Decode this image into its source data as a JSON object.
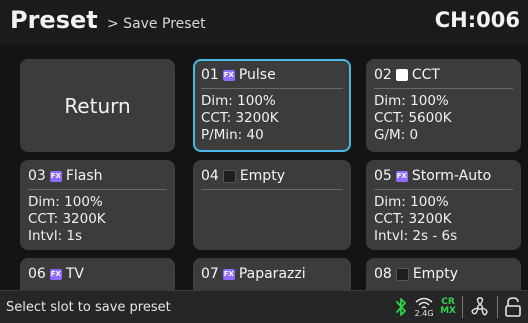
{
  "header": {
    "title": "Preset",
    "breadcrumb": "> Save Preset",
    "channel": "CH:006"
  },
  "return_label": "Return",
  "slots": [
    {
      "num": "01",
      "icon": "fx-icon",
      "name": "Pulse",
      "lines": [
        "Dim: 100%",
        "CCT: 3200K",
        "P/Min: 40"
      ],
      "selected": true
    },
    {
      "num": "02",
      "icon": "cct-white-square-icon",
      "name": "CCT",
      "lines": [
        "Dim: 100%",
        "CCT: 5600K",
        "G/M: 0"
      ]
    },
    {
      "num": "03",
      "icon": "fx-icon",
      "name": "Flash",
      "lines": [
        "Dim: 100%",
        "CCT: 3200K",
        "Intvl: 1s"
      ]
    },
    {
      "num": "04",
      "icon": "empty-square-icon",
      "name": "Empty",
      "lines": []
    },
    {
      "num": "05",
      "icon": "fx-icon",
      "name": "Storm-Auto",
      "lines": [
        "Dim: 100%",
        "CCT: 3200K",
        "Intvl: 2s - 6s"
      ]
    },
    {
      "num": "06",
      "icon": "fx-icon",
      "name": "TV",
      "lines": []
    },
    {
      "num": "07",
      "icon": "fx-icon",
      "name": "Paparazzi",
      "lines": []
    },
    {
      "num": "08",
      "icon": "empty-square-icon",
      "name": "Empty",
      "lines": []
    }
  ],
  "fx_badge": "FX",
  "footer": {
    "status": "Select slot to save preset",
    "freq_label": "2.4G",
    "crmx_top": "CR",
    "crmx_bottom": "MX",
    "icons": [
      "bluetooth-icon",
      "wireless-2-4g-icon",
      "crmx-icon",
      "fan-icon",
      "lock-icon"
    ],
    "colors": {
      "bluetooth": "#2fd14a",
      "crmx": "#34d24c",
      "neutral": "#e6e6e6"
    }
  },
  "colors": {
    "selected_border": "#4ab8e8",
    "tile_bg": "#3c3c3c",
    "fx_badge": "#8f6bff"
  }
}
